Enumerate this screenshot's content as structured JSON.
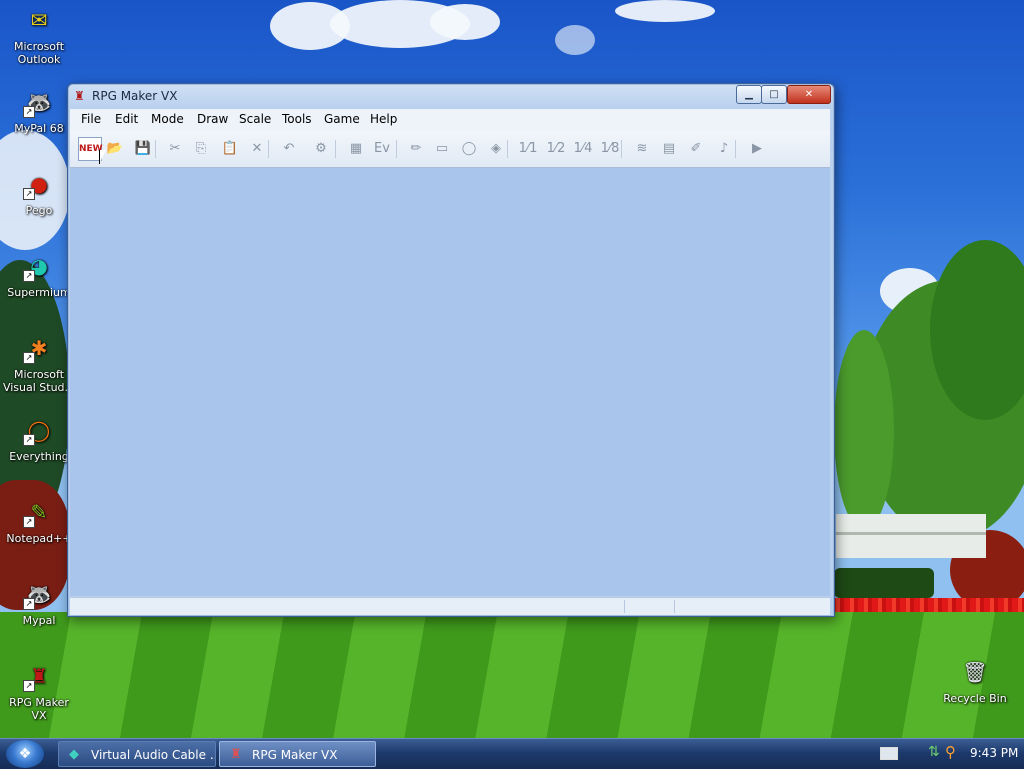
{
  "desktop": {
    "icons": [
      {
        "label": "Microsoft\nOutlook",
        "icon": "outlook-icon",
        "glyph": "✉",
        "color": "#e8d020",
        "shortcut": false
      },
      {
        "label": "MyPal 68",
        "icon": "mypal-icon",
        "glyph": "🦝",
        "color": "#ffffff",
        "shortcut": true
      },
      {
        "label": "Pego",
        "icon": "pego-icon",
        "glyph": "●",
        "color": "#d02010",
        "shortcut": true
      },
      {
        "label": "Supermium",
        "icon": "supermium-icon",
        "glyph": "◕",
        "color": "#20c8b0",
        "shortcut": true
      },
      {
        "label": "Microsoft\nVisual Stud...",
        "icon": "visual-studio-icon",
        "glyph": "✱",
        "color": "#f08020",
        "shortcut": true
      },
      {
        "label": "Everything",
        "icon": "everything-icon",
        "glyph": "◯",
        "color": "#f07010",
        "shortcut": true
      },
      {
        "label": "Notepad++",
        "icon": "notepadpp-icon",
        "glyph": "✎",
        "color": "#80c020",
        "shortcut": true
      },
      {
        "label": "Mypal",
        "icon": "mypal-icon",
        "glyph": "🦝",
        "color": "#ffffff",
        "shortcut": true
      },
      {
        "label": "RPG Maker VX",
        "icon": "rpg-maker-icon",
        "glyph": "♜",
        "color": "#c01818",
        "shortcut": true
      }
    ],
    "recycle_bin": {
      "label": "Recycle Bin",
      "glyph": "🗑"
    }
  },
  "window": {
    "title": "RPG Maker VX",
    "min_glyph": "▁",
    "max_glyph": "□",
    "close_glyph": "✕",
    "menu": [
      "File",
      "Edit",
      "Mode",
      "Draw",
      "Scale",
      "Tools",
      "Game",
      "Help"
    ],
    "toolbar": [
      {
        "name": "new-project-icon",
        "glyph": "NEW",
        "active": true
      },
      {
        "name": "open-project-icon",
        "glyph": "📂",
        "active": true
      },
      {
        "name": "save-project-icon",
        "glyph": "💾",
        "active": false
      },
      {
        "name": "cut-icon",
        "glyph": "✂",
        "active": false
      },
      {
        "name": "copy-icon",
        "glyph": "⎘",
        "active": false
      },
      {
        "name": "paste-icon",
        "glyph": "📋",
        "active": false
      },
      {
        "name": "delete-icon",
        "glyph": "✕",
        "active": false
      },
      {
        "name": "undo-icon",
        "glyph": "↶",
        "active": false
      },
      {
        "name": "map-layer-icon",
        "glyph": "⚙",
        "active": false
      },
      {
        "name": "region-mode-icon",
        "glyph": "▦",
        "active": false
      },
      {
        "name": "event-mode-icon",
        "glyph": "Ev",
        "active": false
      },
      {
        "name": "pencil-icon",
        "glyph": "✏",
        "active": false
      },
      {
        "name": "rectangle-icon",
        "glyph": "▭",
        "active": false
      },
      {
        "name": "ellipse-icon",
        "glyph": "◯",
        "active": false
      },
      {
        "name": "fill-icon",
        "glyph": "◈",
        "active": false
      },
      {
        "name": "scale-1-1-icon",
        "glyph": "1⁄1",
        "active": false
      },
      {
        "name": "scale-1-2-icon",
        "glyph": "1⁄2",
        "active": false
      },
      {
        "name": "scale-1-4-icon",
        "glyph": "1⁄4",
        "active": false
      },
      {
        "name": "scale-1-8-icon",
        "glyph": "1⁄8",
        "active": false
      },
      {
        "name": "database-icon",
        "glyph": "≋",
        "active": false
      },
      {
        "name": "resource-manager-icon",
        "glyph": "▤",
        "active": false
      },
      {
        "name": "script-editor-icon",
        "glyph": "✐",
        "active": false
      },
      {
        "name": "sound-test-icon",
        "glyph": "♪",
        "active": false
      },
      {
        "name": "playtest-icon",
        "glyph": "▶",
        "active": false
      }
    ]
  },
  "taskbar": {
    "start_glyph": "❖",
    "tasks": [
      {
        "label": "Virtual Audio Cable ...",
        "glyph": "◆",
        "active": false
      },
      {
        "label": "RPG Maker VX",
        "glyph": "♜",
        "active": true
      }
    ],
    "clock": "9:43 PM"
  }
}
